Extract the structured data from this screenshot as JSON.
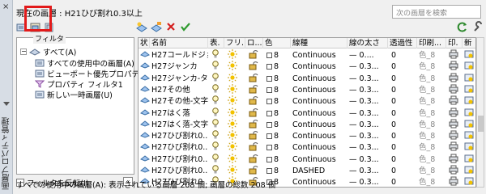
{
  "side_strip": {
    "title": "画層プロパティ管理",
    "close": "×"
  },
  "header": {
    "current_layer": "現在の画層 : H21ひび割れ0.3以上"
  },
  "search": {
    "placeholder": "次の画層を検索"
  },
  "tree": {
    "filter_label": "フィルタ",
    "items": [
      {
        "label": "すべて(A)",
        "level": 0
      },
      {
        "label": "すべての使用中の画層(A)",
        "level": 1
      },
      {
        "label": "ビューポート優先プロパティを",
        "level": 1
      },
      {
        "label": "プロパティ フィルタ1",
        "level": 1
      },
      {
        "label": "新しい一時画層(U)",
        "level": 1
      }
    ]
  },
  "invert_filter": {
    "label": "フィルタを反転(I)"
  },
  "grid": {
    "columns": [
      "状",
      "名前",
      "表.",
      "フリ...",
      "ロ...",
      "色",
      "線種",
      "線の太さ",
      "透過性",
      "印刷...",
      "印.",
      "新"
    ],
    "rows": [
      {
        "name": "H27コールドジョ...",
        "color": "8",
        "linetype": "Continuous",
        "lineweight": "— 0....",
        "transparency": "0",
        "plot_style": "色_8"
      },
      {
        "name": "H27ジャンカ",
        "color": "8",
        "linetype": "Continuous",
        "lineweight": "— 0.3...",
        "transparency": "0",
        "plot_style": "色_8"
      },
      {
        "name": "H27ジャンカ-ター",
        "color": "8",
        "linetype": "Continuous",
        "lineweight": "— 0.3...",
        "transparency": "0",
        "plot_style": "色_8"
      },
      {
        "name": "H27その他",
        "color": "8",
        "linetype": "Continuous",
        "lineweight": "— 0.3...",
        "transparency": "0",
        "plot_style": "色_8"
      },
      {
        "name": "H27その他-文字",
        "color": "8",
        "linetype": "Continuous",
        "lineweight": "— 0.3...",
        "transparency": "0",
        "plot_style": "色_8"
      },
      {
        "name": "H27はく落",
        "color": "8",
        "linetype": "Continuous",
        "lineweight": "— 0.3...",
        "transparency": "0",
        "plot_style": "色_8"
      },
      {
        "name": "H27はく落-文字",
        "color": "8",
        "linetype": "Continuous",
        "lineweight": "— 0.3...",
        "transparency": "0",
        "plot_style": "色_8"
      },
      {
        "name": "H27ひび割れ0....",
        "color": "8",
        "linetype": "Continuous",
        "lineweight": "— 0.3...",
        "transparency": "0",
        "plot_style": "色_8"
      },
      {
        "name": "H27ひび割れ0....",
        "color": "8",
        "linetype": "Continuous",
        "lineweight": "— 0.3...",
        "transparency": "0",
        "plot_style": "色_8"
      },
      {
        "name": "H27ひび割れ0....",
        "color": "8",
        "linetype": "Continuous",
        "lineweight": "— 0.3...",
        "transparency": "0",
        "plot_style": "色_8"
      },
      {
        "name": "H27ひび割れ0....",
        "color": "8",
        "linetype": "DASHED",
        "lineweight": "— 0.3...",
        "transparency": "0",
        "plot_style": "色_8"
      },
      {
        "name": "H27ひび割れ0....",
        "color": "8",
        "linetype": "Continuous",
        "lineweight": "— 0.3...",
        "transparency": "0",
        "plot_style": "色_8"
      }
    ]
  },
  "status": {
    "text": "すべての使用中の画層(A): 表示されている画層 208 個, 画層の総数 208 個"
  },
  "colors": {
    "highlight": "#e21a1a",
    "layer_icon": "#3a7bd5",
    "bulb": "#f2c200"
  }
}
